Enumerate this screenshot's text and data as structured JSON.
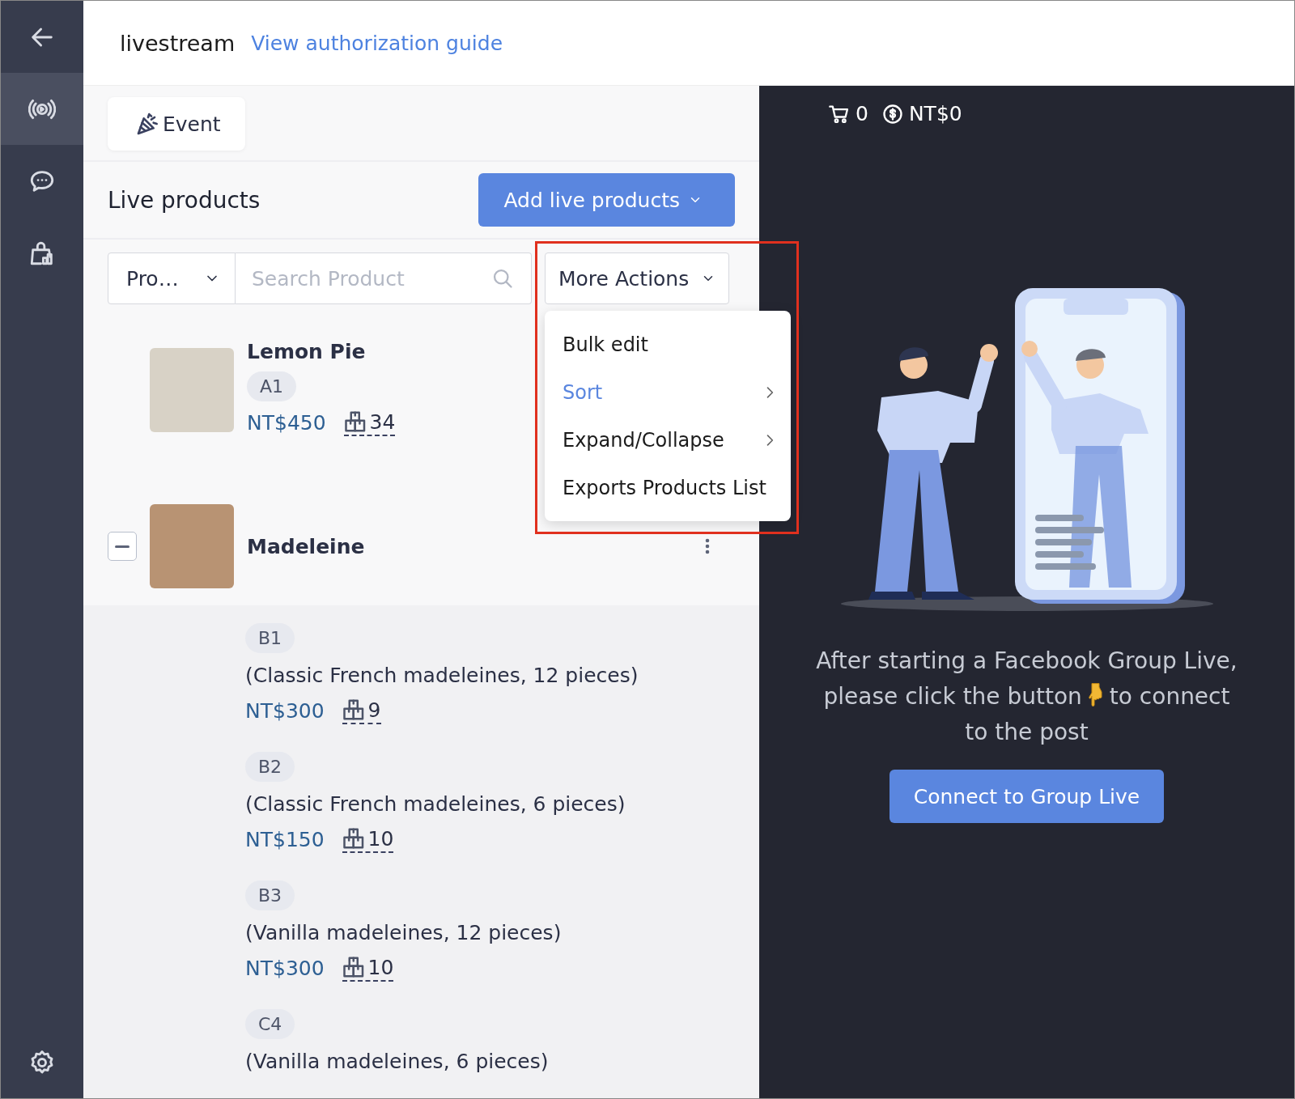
{
  "sidebar": {
    "items": [
      {
        "kind": "back",
        "selected": false
      },
      {
        "kind": "live",
        "selected": true
      },
      {
        "kind": "chat",
        "selected": false
      },
      {
        "kind": "shop",
        "selected": false
      }
    ],
    "footer": {
      "kind": "settings"
    }
  },
  "header": {
    "title": "livestream",
    "link": "View authorization guide"
  },
  "event_button": "Event",
  "products_panel": {
    "title": "Live products",
    "add_button": "Add live products",
    "filter": {
      "select": "Pro…",
      "search": {
        "placeholder": "Search Product"
      },
      "more_actions": "More Actions"
    },
    "menu": {
      "highlighted": true,
      "items": [
        {
          "label": "Bulk edit",
          "selected": false,
          "submenu": false
        },
        {
          "label": "Sort",
          "selected": true,
          "submenu": true
        },
        {
          "label": "Expand/Collapse",
          "selected": false,
          "submenu": true
        },
        {
          "label": "Exports Products List",
          "selected": false,
          "submenu": false
        }
      ]
    },
    "products": [
      {
        "kind": "single",
        "name": "Lemon Pie",
        "code": "A1",
        "price": "NT$450",
        "stock": "34"
      },
      {
        "kind": "group",
        "name": "Madeleine",
        "expanded": true,
        "variants": [
          {
            "code": "B1",
            "description": "(Classic French madeleines, 12 pieces)",
            "price": "NT$300",
            "stock": "9"
          },
          {
            "code": "B2",
            "description": "(Classic French madeleines, 6 pieces)",
            "price": "NT$150",
            "stock": "10"
          },
          {
            "code": "B3",
            "description": "(Vanilla madeleines, 12 pieces)",
            "price": "NT$300",
            "stock": "10"
          },
          {
            "code": "C4",
            "description": "(Vanilla madeleines, 6 pieces)"
          }
        ]
      }
    ]
  },
  "live_panel": {
    "cart_count": "0",
    "total": "NT$0",
    "message_lines": [
      {
        "text": "After starting a Facebook Group Live,"
      },
      {
        "text": "please click the button",
        "text_after": "to connect"
      },
      {
        "text": "to the post"
      }
    ],
    "connect_button": "Connect to Group Live"
  }
}
